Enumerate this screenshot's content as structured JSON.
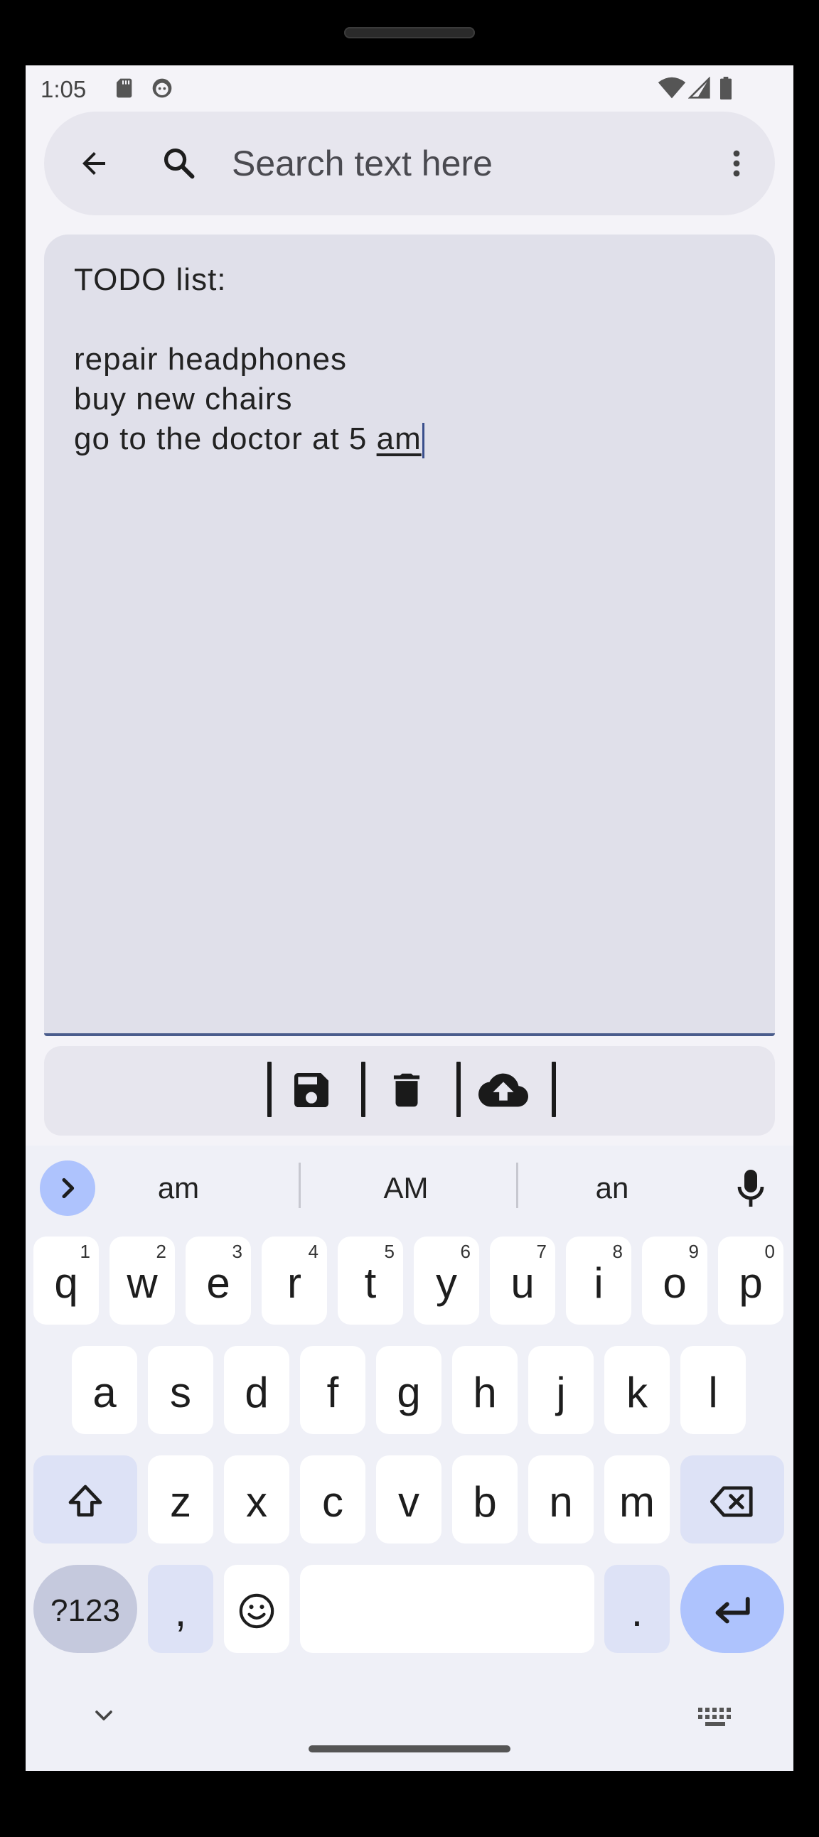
{
  "status_bar": {
    "time": "1:05",
    "left_icons": [
      "sd-card-icon",
      "android-robot-icon"
    ],
    "right_icons": [
      "wifi-icon",
      "cell-signal-icon",
      "battery-icon"
    ]
  },
  "search_bar": {
    "back_icon": "arrow-left-icon",
    "search_icon": "search-icon",
    "placeholder": "Search text here",
    "menu_icon": "more-vertical-icon"
  },
  "note": {
    "line1": "TODO list:",
    "line2": "",
    "line3": "repair headphones",
    "line4": "buy new chairs",
    "line5_prefix": "go to the doctor at 5 ",
    "line5_composing": "am"
  },
  "toolbar": {
    "buttons": [
      "save-icon",
      "trash-icon",
      "cloud-upload-icon"
    ]
  },
  "keyboard": {
    "suggestions": [
      "am",
      "AM",
      "an"
    ],
    "row1": [
      {
        "key": "q",
        "hint": "1"
      },
      {
        "key": "w",
        "hint": "2"
      },
      {
        "key": "e",
        "hint": "3"
      },
      {
        "key": "r",
        "hint": "4"
      },
      {
        "key": "t",
        "hint": "5"
      },
      {
        "key": "y",
        "hint": "6"
      },
      {
        "key": "u",
        "hint": "7"
      },
      {
        "key": "i",
        "hint": "8"
      },
      {
        "key": "o",
        "hint": "9"
      },
      {
        "key": "p",
        "hint": "0"
      }
    ],
    "row2": [
      "a",
      "s",
      "d",
      "f",
      "g",
      "h",
      "j",
      "k",
      "l"
    ],
    "row3": [
      "z",
      "x",
      "c",
      "v",
      "b",
      "n",
      "m"
    ],
    "symbols_label": "?123",
    "comma": ",",
    "period": ".",
    "colors": {
      "accent": "#aec3fd",
      "function_key": "#dde2f6",
      "key": "#ffffff"
    }
  }
}
